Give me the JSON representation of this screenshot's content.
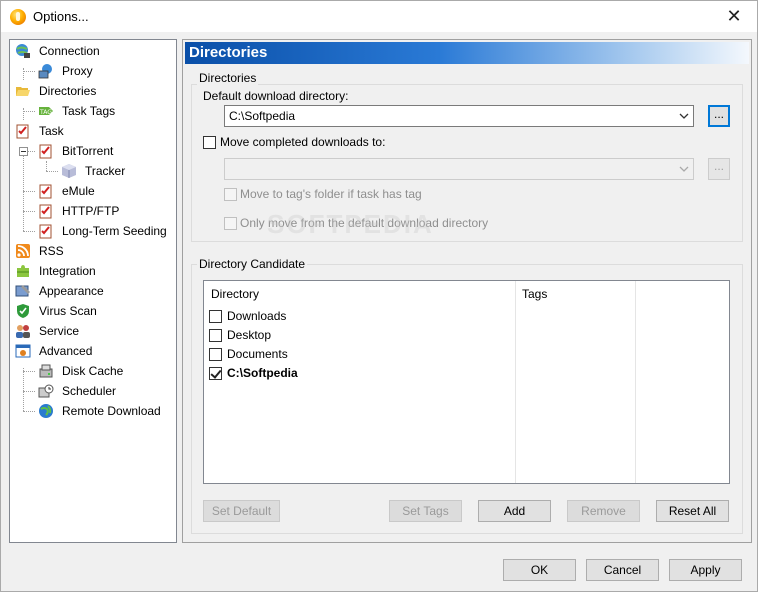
{
  "window": {
    "title": "Options...",
    "close_glyph": "✕"
  },
  "tree": {
    "items": [
      {
        "label": "Connection",
        "icon": "globe-network-icon"
      },
      {
        "label": "Proxy",
        "icon": "network-computer-icon"
      },
      {
        "label": "Directories",
        "icon": "open-folder-icon"
      },
      {
        "label": "Task Tags",
        "icon": "tag-icon"
      },
      {
        "label": "Task",
        "icon": "clipboard-check-icon"
      },
      {
        "label": "BitTorrent",
        "icon": "clipboard-check-icon"
      },
      {
        "label": "Tracker",
        "icon": "cube-icon"
      },
      {
        "label": "eMule",
        "icon": "clipboard-check-icon"
      },
      {
        "label": "HTTP/FTP",
        "icon": "clipboard-check-icon"
      },
      {
        "label": "Long-Term Seeding",
        "icon": "clipboard-check-icon"
      },
      {
        "label": "RSS",
        "icon": "rss-icon"
      },
      {
        "label": "Integration",
        "icon": "puzzle-icon"
      },
      {
        "label": "Appearance",
        "icon": "appearance-icon"
      },
      {
        "label": "Virus Scan",
        "icon": "shield-icon"
      },
      {
        "label": "Service",
        "icon": "users-icon"
      },
      {
        "label": "Advanced",
        "icon": "advanced-icon"
      },
      {
        "label": "Disk Cache",
        "icon": "disk-icon"
      },
      {
        "label": "Scheduler",
        "icon": "scheduler-icon"
      },
      {
        "label": "Remote Download",
        "icon": "globe-icon"
      }
    ]
  },
  "panel": {
    "header": "Directories",
    "directories_group": {
      "title": "Directories",
      "default_label": "Default download directory:",
      "default_value": "C:\\Softpedia",
      "browse_label": "...",
      "move_completed_label": "Move completed downloads to:",
      "move_completed_value": "",
      "move_browse_label": "...",
      "move_tag_label": "Move to tag's folder if task has tag",
      "only_default_label": "Only move from the default download directory"
    },
    "candidate_group": {
      "title": "Directory Candidate",
      "columns": [
        "Directory",
        "Tags"
      ],
      "rows": [
        {
          "label": "Downloads",
          "checked": false
        },
        {
          "label": "Desktop",
          "checked": false
        },
        {
          "label": "Documents",
          "checked": false
        },
        {
          "label": "C:\\Softpedia",
          "checked": true
        }
      ],
      "buttons": {
        "set_default": "Set Default",
        "set_tags": "Set Tags",
        "add": "Add",
        "remove": "Remove",
        "reset_all": "Reset All"
      }
    }
  },
  "footer": {
    "ok": "OK",
    "cancel": "Cancel",
    "apply": "Apply"
  },
  "watermark": "SOFTPEDIA",
  "colors": {
    "header_start": "#0a4fa8",
    "header_end": "#f4f8fd",
    "focus": "#0078d7"
  }
}
